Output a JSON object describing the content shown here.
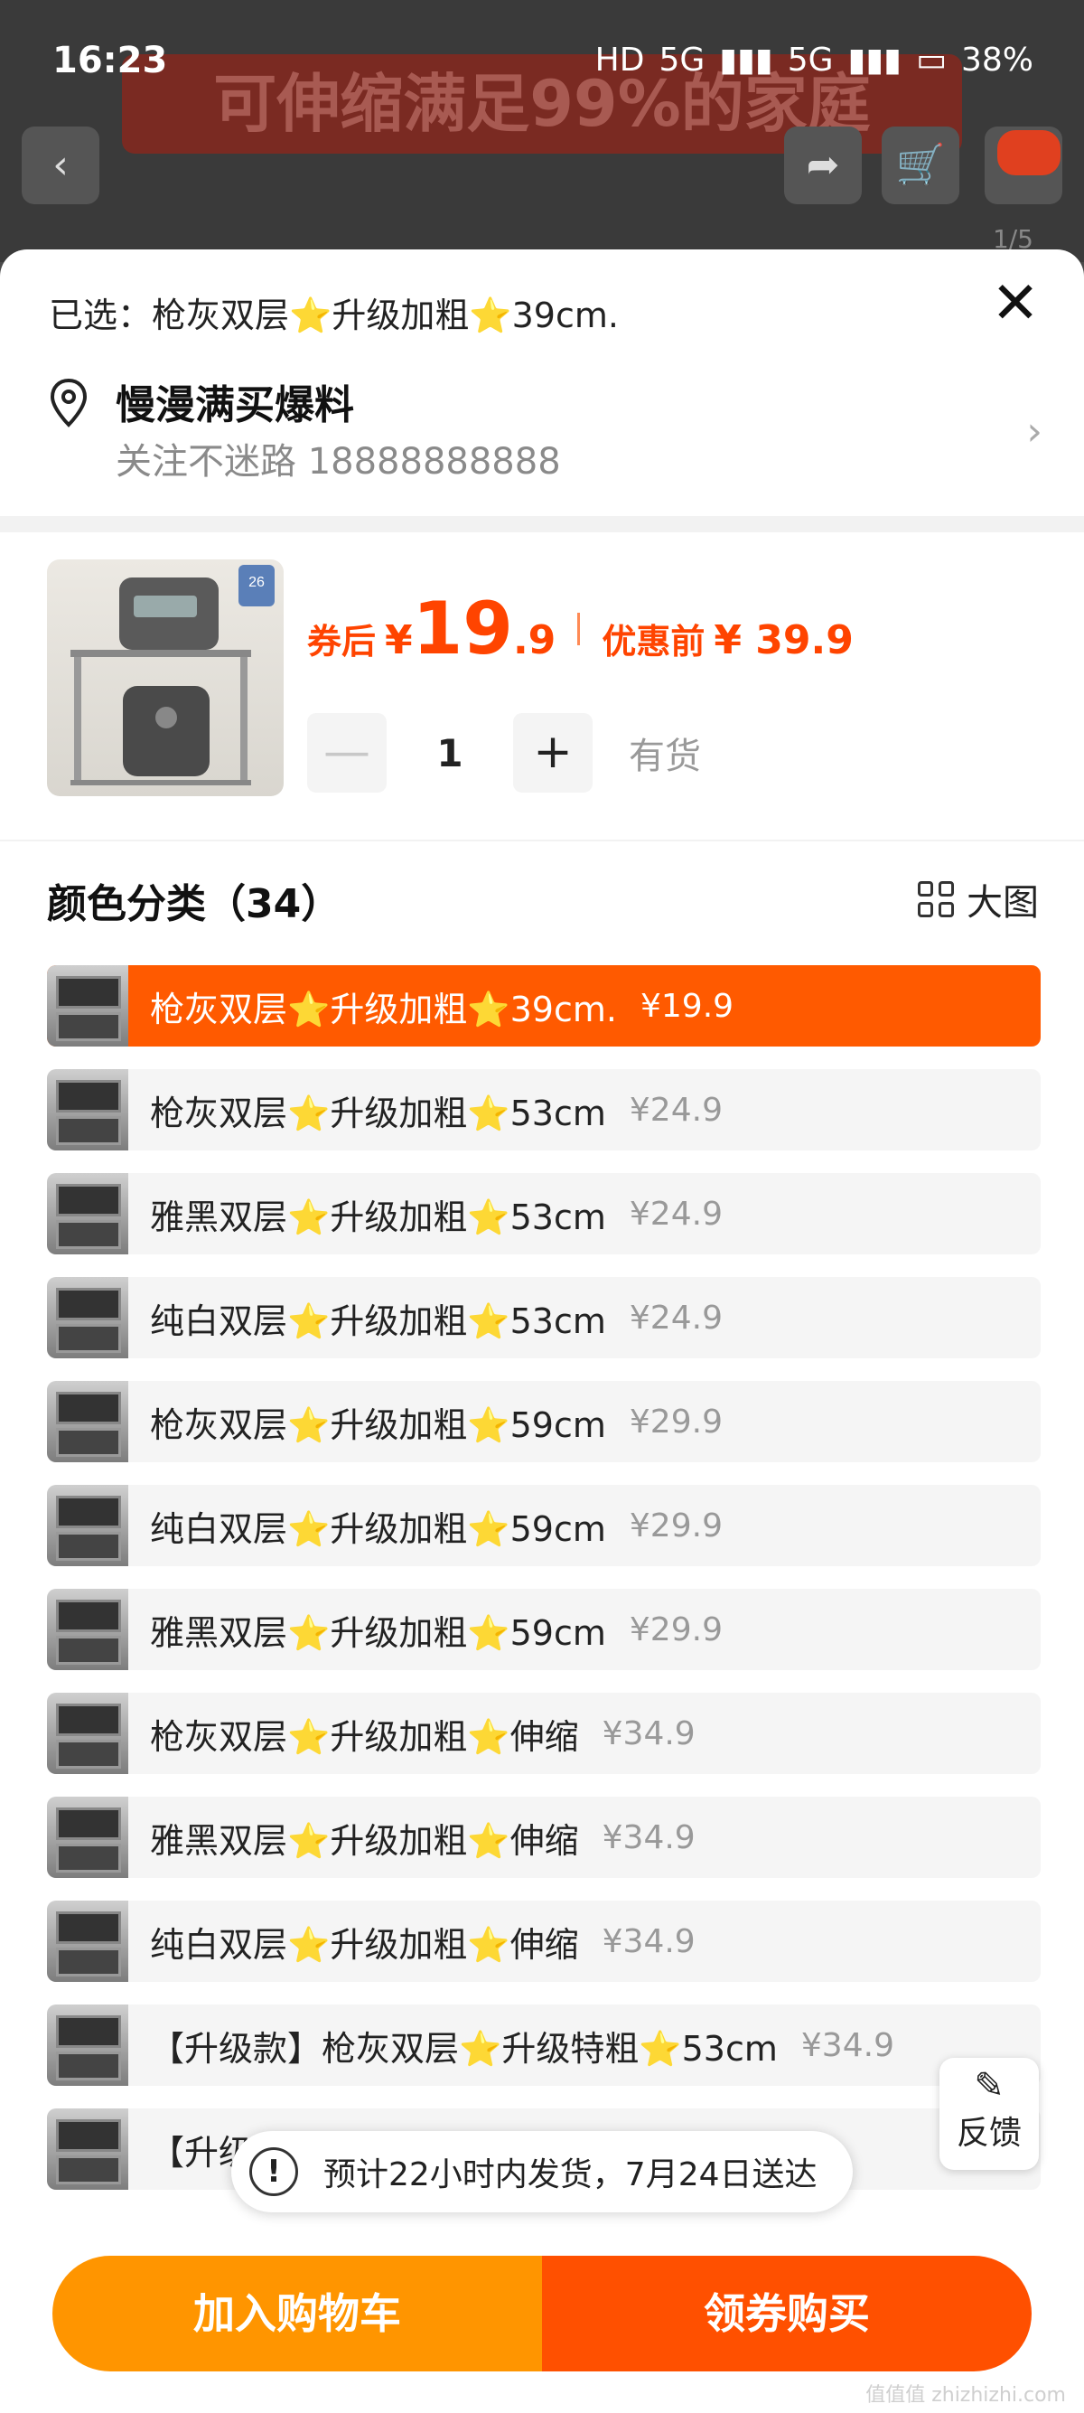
{
  "status_bar": {
    "time": "16:23",
    "network1": "5G",
    "network2": "5G",
    "battery": "38%"
  },
  "backdrop": {
    "banner_text": "可伸缩满足99%的家庭",
    "pager": "1/5"
  },
  "sheet": {
    "selected_text": "已选：枪灰双层⭐升级加粗⭐39cm.",
    "address_title": "慢漫满买爆料",
    "address_sub": "关注不迷路 18888888888"
  },
  "product": {
    "price_label": "券后",
    "price_yen": "¥",
    "price_int": "19",
    "price_dec": ".9",
    "orig_label": "优惠前",
    "orig_value": "¥ 39.9",
    "quantity": "1",
    "minus": "—",
    "plus": "+",
    "stock": "有货",
    "thumb_badge": "26"
  },
  "category": {
    "header": "颜色分类（34）",
    "bigview_label": "大图"
  },
  "options": [
    {
      "name": "枪灰双层⭐升级加粗⭐39cm.",
      "price": "¥19.9",
      "selected": true
    },
    {
      "name": "枪灰双层⭐升级加粗⭐53cm",
      "price": "¥24.9"
    },
    {
      "name": "雅黑双层⭐升级加粗⭐53cm",
      "price": "¥24.9"
    },
    {
      "name": "纯白双层⭐升级加粗⭐53cm",
      "price": "¥24.9"
    },
    {
      "name": "枪灰双层⭐升级加粗⭐59cm",
      "price": "¥29.9"
    },
    {
      "name": "纯白双层⭐升级加粗⭐59cm",
      "price": "¥29.9"
    },
    {
      "name": "雅黑双层⭐升级加粗⭐59cm",
      "price": "¥29.9"
    },
    {
      "name": "枪灰双层⭐升级加粗⭐伸缩",
      "price": "¥34.9"
    },
    {
      "name": "雅黑双层⭐升级加粗⭐伸缩",
      "price": "¥34.9"
    },
    {
      "name": "纯白双层⭐升级加粗⭐伸缩",
      "price": "¥34.9"
    },
    {
      "name": "【升级款】枪灰双层⭐升级特粗⭐53cm",
      "price": "¥34.9"
    },
    {
      "name": "【升级款】",
      "price": "¥34.9"
    }
  ],
  "feedback": {
    "label": "反馈"
  },
  "toast": {
    "icon": "!",
    "text": "预计22小时内发货，7月24日送达"
  },
  "actions": {
    "add_cart": "加入购物车",
    "buy": "领券购买"
  },
  "watermark": "值值值 zhizhizhi.com",
  "colors": {
    "accent": "#ff5000",
    "cart": "#ff9500",
    "price": "#ff4400"
  }
}
